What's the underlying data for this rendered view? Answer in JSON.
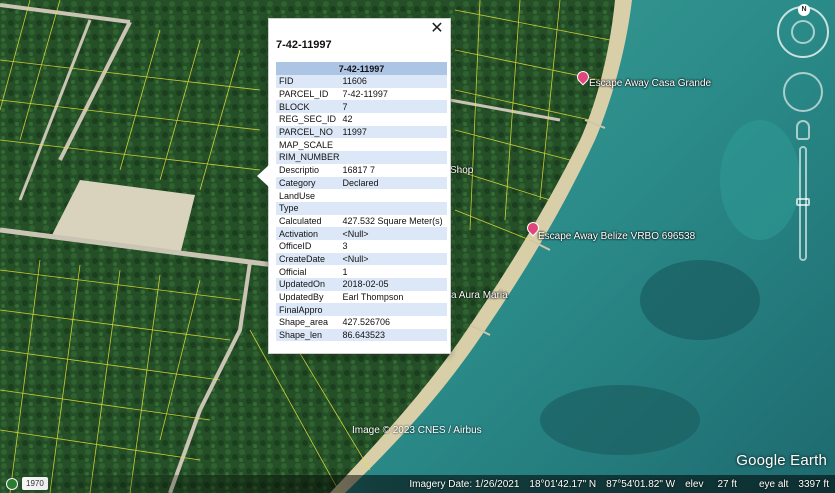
{
  "map": {
    "places": [
      {
        "name": "Escape Away Casa Grande",
        "pin": true
      },
      {
        "name": "Escape Away Belize VRBO 696538",
        "pin": true
      },
      {
        "name": "Shop",
        "pin": false
      },
      {
        "name": "a Aura Maria",
        "pin": false
      }
    ],
    "credit": "Image © 2023 CNES / Airbus",
    "brand": "Google Earth"
  },
  "nav": {
    "compass_letter": "N"
  },
  "statusbar": {
    "historical_year": "1970",
    "imagery_date": "Imagery Date: 1/26/2021",
    "latitude": "18°01'42.17\" N",
    "longitude": "87°54'01.82\" W",
    "elev_label": "elev",
    "elev_value": "27 ft",
    "eye_alt_label": "eye alt",
    "eye_alt_value": "3397 ft"
  },
  "popup": {
    "title": "7-42-11997",
    "table_header": "7-42-11997",
    "rows": [
      {
        "key": "FID",
        "value": "11606"
      },
      {
        "key": "PARCEL_ID",
        "value": "7-42-11997"
      },
      {
        "key": "BLOCK",
        "value": "7"
      },
      {
        "key": "REG_SEC_ID",
        "value": "42"
      },
      {
        "key": "PARCEL_NO",
        "value": "11997"
      },
      {
        "key": "MAP_SCALE",
        "value": ""
      },
      {
        "key": "RIM_NUMBER",
        "value": ""
      },
      {
        "key": "Descriptio",
        "value": "16817 7"
      },
      {
        "key": "Category",
        "value": "Declared"
      },
      {
        "key": "LandUse",
        "value": ""
      },
      {
        "key": "Type",
        "value": ""
      },
      {
        "key": "Calculated",
        "value": "427.532 Square Meter(s)"
      },
      {
        "key": "Activation",
        "value": "<Null>"
      },
      {
        "key": "OfficeID",
        "value": "3"
      },
      {
        "key": "CreateDate",
        "value": "<Null>"
      },
      {
        "key": "Official",
        "value": "1"
      },
      {
        "key": "UpdatedOn",
        "value": "2018-02-05"
      },
      {
        "key": "UpdatedBy",
        "value": "Earl Thompson"
      },
      {
        "key": "FinalAppro",
        "value": ""
      },
      {
        "key": "Shape_area",
        "value": "427.526706"
      },
      {
        "key": "Shape_len",
        "value": "86.643523"
      }
    ]
  },
  "colors": {
    "land": "#1f4a24",
    "sea_shallow": "#2d8f8c",
    "sea_deep": "#1a5e63",
    "parcel_lines": "#e8e23a",
    "popup_header": "#adc5e4",
    "popup_row": "#dce8f7"
  }
}
